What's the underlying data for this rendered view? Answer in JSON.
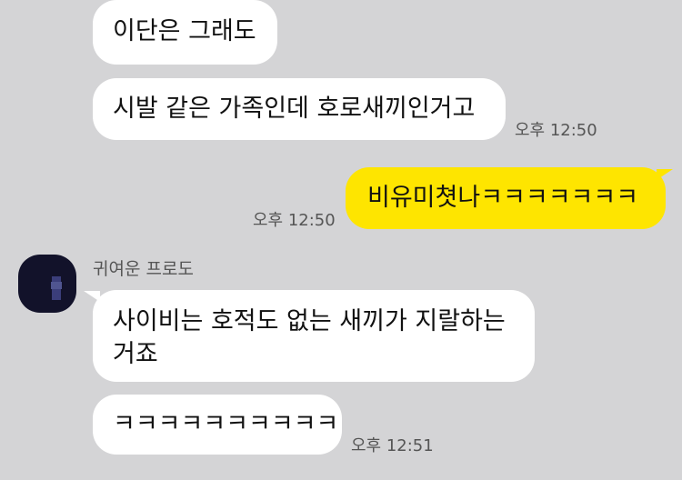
{
  "colors": {
    "background": "#d4d4d6",
    "incoming_bubble": "#ffffff",
    "outgoing_bubble": "#fee500",
    "timestamp_text": "#555555"
  },
  "messages": [
    {
      "direction": "in",
      "text": "이단은 그래도"
    },
    {
      "direction": "in",
      "text": "시발 같은 가족인데 호로새끼인거고",
      "time": "오후 12:50"
    },
    {
      "direction": "out",
      "text": "비유미쳣나ㅋㅋㅋㅋㅋㅋㅋ",
      "time": "오후 12:50"
    },
    {
      "direction": "in",
      "sender": "귀여운 프로도",
      "avatar_icon": "profile-avatar",
      "text_line1": "사이비는 호적도 없는 새끼가 지랄하는",
      "text_line2": "거죠"
    },
    {
      "direction": "in",
      "text": "ㅋㅋㅋㅋㅋㅋㅋㅋㅋㅋ",
      "time": "오후 12:51"
    }
  ]
}
